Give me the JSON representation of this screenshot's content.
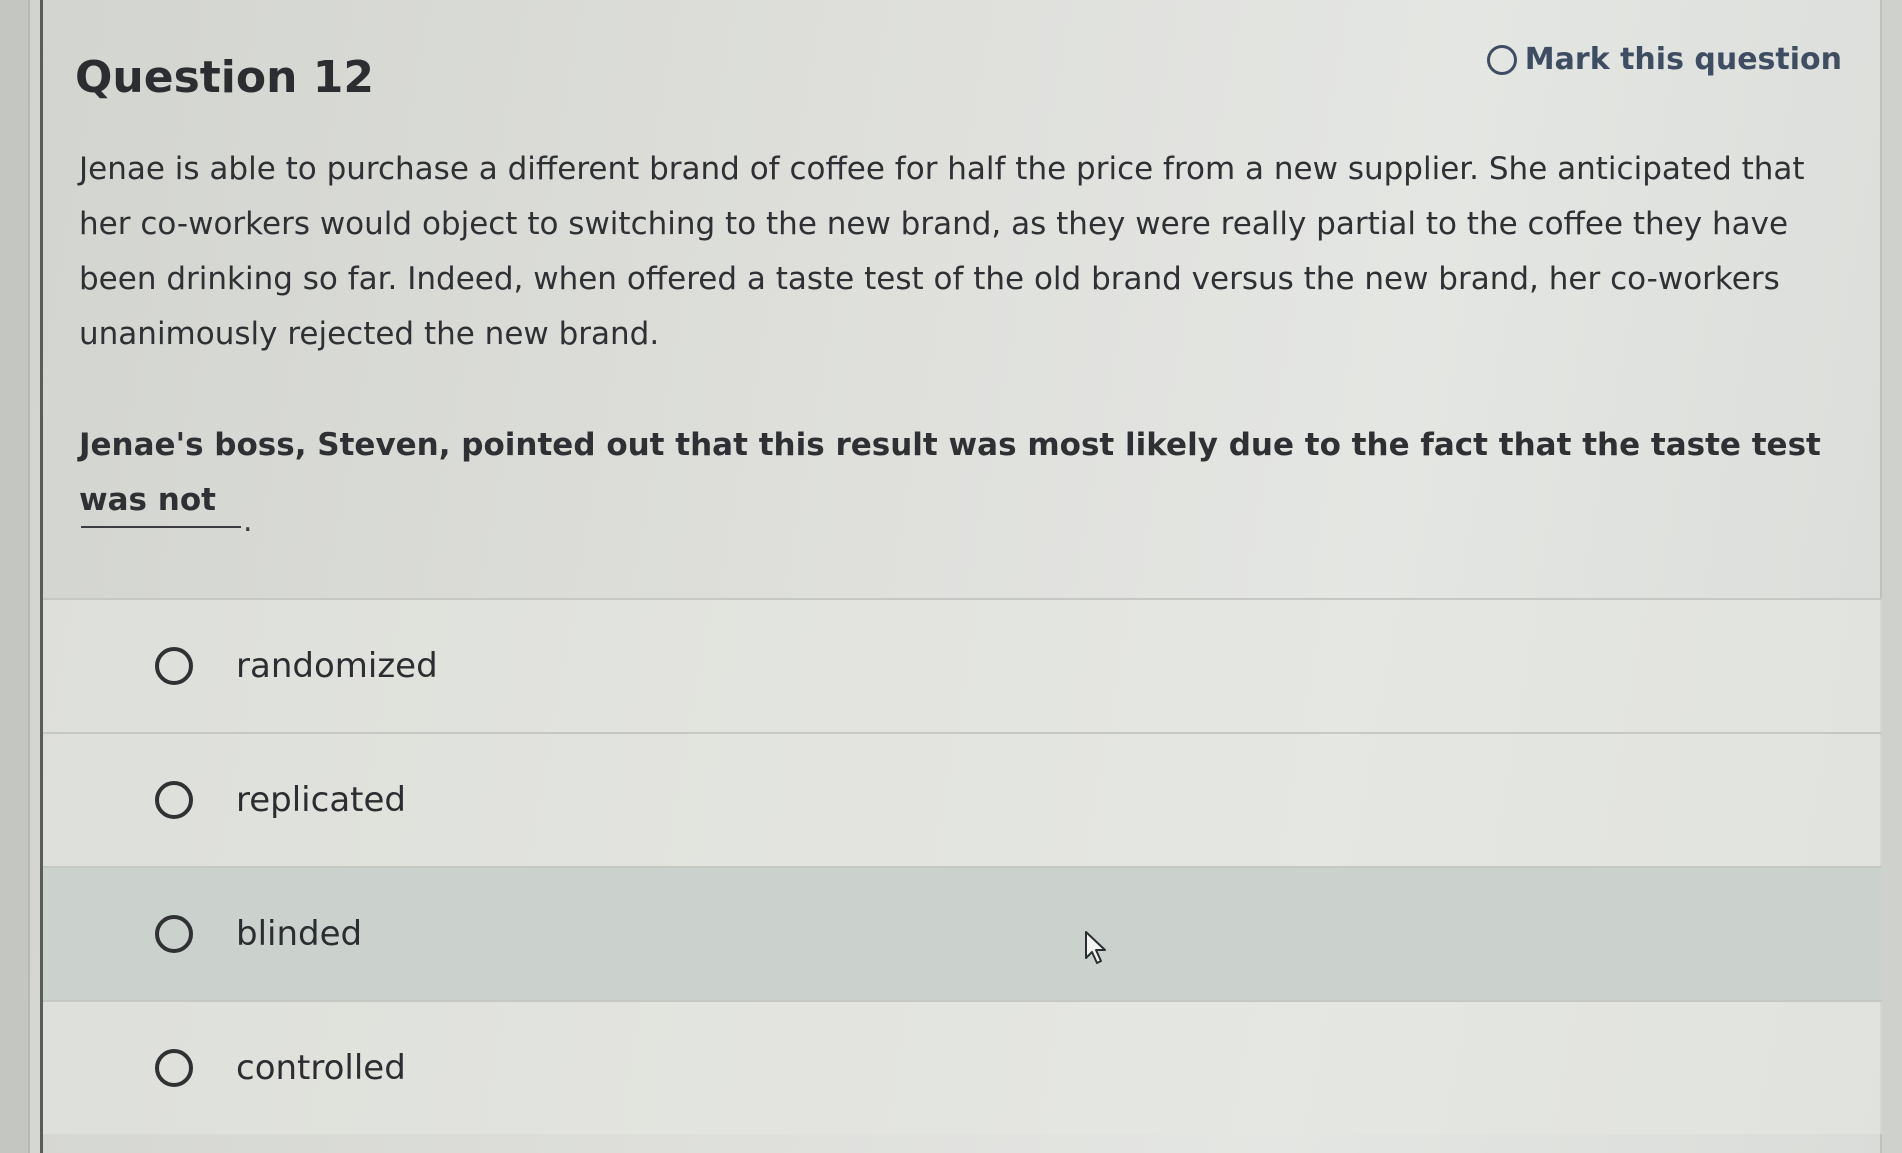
{
  "question": {
    "title": "Question 12",
    "mark_label": "Mark this question",
    "stem": "Jenae is able to purchase a different brand of coffee for half the price from a new supplier. She anticipated that her co-workers would object to switching to the new brand, as they were really partial to the coffee they have been drinking so far. Indeed, when offered a taste test of the old brand versus the new brand, her co-workers unanimously rejected the new brand.",
    "prompt": "Jenae's boss, Steven, pointed out that this result was most likely due to the fact that the taste test was not",
    "blank_suffix": "."
  },
  "options": [
    {
      "label": "randomized"
    },
    {
      "label": "replicated"
    },
    {
      "label": "blinded"
    },
    {
      "label": "controlled"
    }
  ],
  "colors": {
    "text": "#2e3033",
    "accent": "#3f4d63",
    "hover_row": "#cbd2ce"
  },
  "icons": {
    "mark": "radio-ring-icon",
    "option": "radio-button-icon",
    "cursor": "mouse-pointer-icon"
  }
}
